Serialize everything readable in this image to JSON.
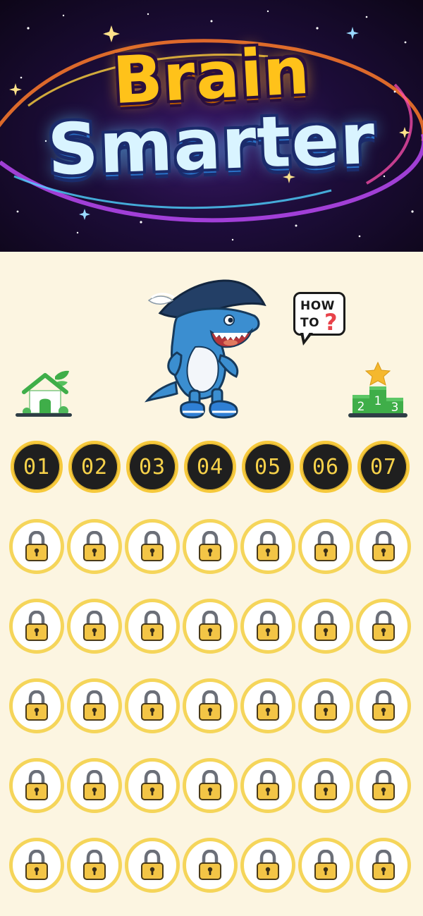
{
  "banner": {
    "title_line1": "Brain",
    "title_line2": "Smarter"
  },
  "controls": {
    "home_icon": "house-icon",
    "howto_line1": "HOW",
    "howto_line2": "TO",
    "howto_symbol": "?",
    "leaderboard_icon": "podium-icon",
    "podium_places": [
      "2",
      "1",
      "3"
    ]
  },
  "mascot": {
    "icon": "pirate-shark-mascot"
  },
  "levels": {
    "total": 42,
    "columns": 7,
    "unlocked": [
      "01",
      "02",
      "03",
      "04",
      "05",
      "06",
      "07"
    ],
    "locked_icon": "padlock-icon"
  },
  "colors": {
    "background": "#fcf5e1",
    "level_ring": "#f6c93c",
    "level_fill_unlocked": "#1f1f1f",
    "level_number": "#f7d24a",
    "lock_body": "#f3c546"
  }
}
